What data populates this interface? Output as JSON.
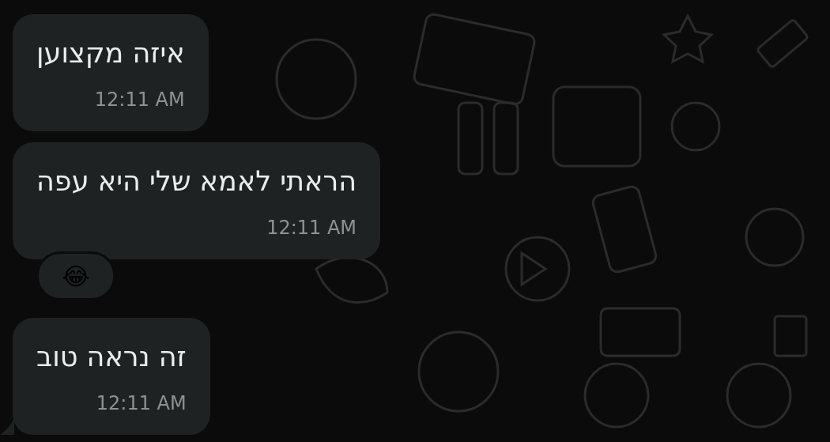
{
  "messages": [
    {
      "text": "איזה מקצוען",
      "time": "12:11 AM"
    },
    {
      "text": "הראתי לאמא שלי היא עפה",
      "time": "12:11 AM",
      "reaction": "😂"
    },
    {
      "text": "זה נראה טוב",
      "time": "12:11 AM"
    }
  ]
}
